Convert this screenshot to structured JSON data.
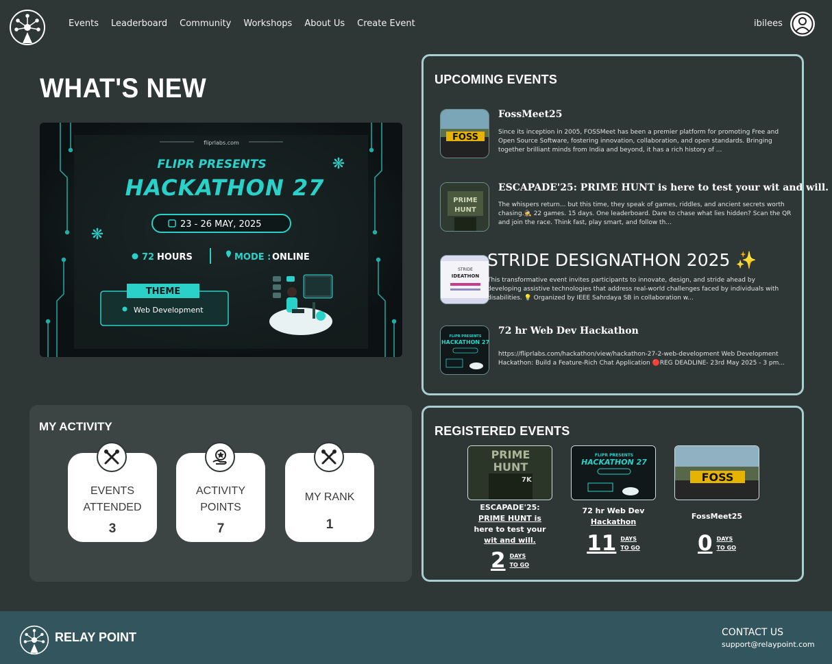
{
  "nav": {
    "links": [
      "Events",
      "Leaderboard",
      "Community",
      "Workshops",
      "About Us",
      "Create Event"
    ],
    "username": "ibilees"
  },
  "whats_new": {
    "title": "WHAT'S NEW",
    "banner": {
      "site": "fliprlabs.com",
      "presents": "FLIPR PRESENTS",
      "headline": "HACKATHON 27",
      "dates": "23 - 26 MAY, 2025",
      "hours_num": "72",
      "hours_label": "HOURS",
      "mode_label": "MODE :",
      "mode_value": "ONLINE",
      "theme_label": "THEME",
      "theme_value": "Web Development"
    }
  },
  "upcoming": {
    "title": "UPCOMING EVENTS",
    "events": [
      {
        "title": "FossMeet25",
        "desc": "Since its inception in 2005, FOSSMeet has been a premier platform for promoting Free and Open Source Software, fostering innovation, collaboration, and open standards. Bringing together brilliant minds from India and beyond, it has a rich history of ..."
      },
      {
        "title": "ESCAPADE'25: PRIME HUNT is here to test your wit and will.",
        "desc": "The whispers return... but this time, they speak of games, riddles, and ancient secrets worth chasing.🕵 22 games. 15 days. One leaderboard. Dare to chase what lies hidden? Scan the QR and join the race. Think fast, play smart, and follow th..."
      },
      {
        "title": "STRIDE DESIGNATHON 2025 ✨",
        "desc": "This transformative event invites participants to innovate, design, and stride ahead by developing assistive technologies that address real-world challenges faced by individuals with disabilities. 💡 Organized by IEEE Sahrdaya SB in collaboration w..."
      },
      {
        "title": "72 hr Web Dev Hackathon",
        "desc": "https://fliprlabs.com/hackathon/view/hackathon-27-2-web-development Web Development Hackathon: Build a Feature-Rich Chat Application 🔴REG DEADLINE- 23rd May 2025 - 3 pm..."
      }
    ]
  },
  "activity": {
    "title": "MY ACTIVITY",
    "cards": [
      {
        "label1": "EVENTS",
        "label2": "ATTENDED",
        "value": "3",
        "icon": "tools-icon"
      },
      {
        "label1": "ACTIVITY",
        "label2": "POINTS",
        "value": "7",
        "icon": "star-hand-icon"
      },
      {
        "label1": "MY RANK",
        "label2": "",
        "value": "1",
        "icon": "tools-icon"
      }
    ]
  },
  "registered": {
    "title": "REGISTERED EVENTS",
    "events": [
      {
        "name_lines": [
          "ESCAPADE'25:",
          "PRIME HUNT is",
          "here to test your",
          "wit and will."
        ],
        "days": "2",
        "lbl1": "DAYS",
        "lbl2": "TO GO"
      },
      {
        "name_lines": [
          "72 hr Web Dev",
          "Hackathon"
        ],
        "days": "11",
        "lbl1": "DAYS",
        "lbl2": "TO GO"
      },
      {
        "name_lines": [
          "FossMeet25"
        ],
        "days": "0",
        "lbl1": "DAYS",
        "lbl2": "TO GO"
      }
    ]
  },
  "footer": {
    "brand": "RELAY POINT",
    "contact_title": "CONTACT US",
    "contact_email": "support@relaypoint.com"
  },
  "colors": {
    "background": "#2f3636",
    "panel_border": "#a8d0d0",
    "activity_bg": "#3d4444",
    "footer_bg": "#33555e",
    "accent_teal": "#2ad1c9"
  }
}
